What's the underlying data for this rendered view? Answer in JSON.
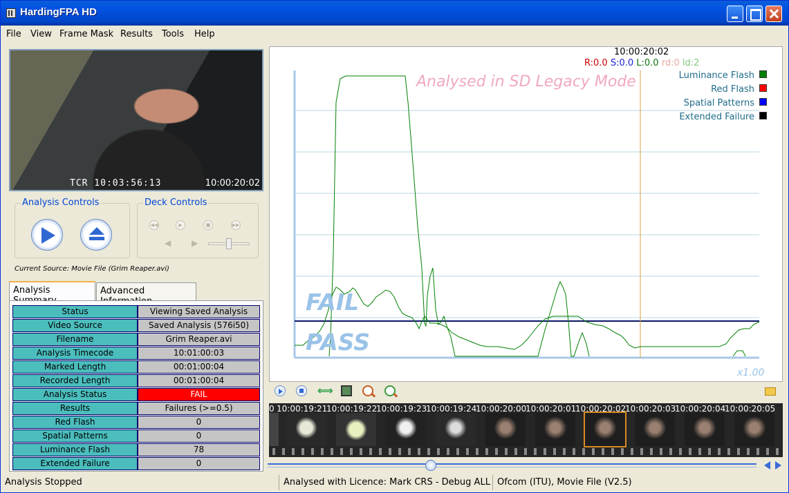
{
  "window": {
    "title": "HardingFPA HD"
  },
  "menu": [
    "File",
    "View",
    "Frame Mask",
    "Results",
    "Tools",
    "Help"
  ],
  "video": {
    "tcr": "TCR 10:03:56:13",
    "timecode": "10:00:20:02"
  },
  "analysis_controls": {
    "label": "Analysis Controls"
  },
  "deck_controls": {
    "label": "Deck Controls"
  },
  "current_source": "Current Source: Movie File (Grim Reaper.avi)",
  "tabs": [
    "Analysis Summary",
    "Advanced Information"
  ],
  "summary": [
    {
      "key": "Status",
      "value": "Viewing Saved Analysis"
    },
    {
      "key": "Video Source",
      "value": "Saved Analysis (576i50)"
    },
    {
      "key": "Filename",
      "value": "Grim Reaper.avi"
    },
    {
      "key": "Analysis Timecode",
      "value": "10:01:00:03"
    },
    {
      "key": "Marked Length",
      "value": "00:01:00:04"
    },
    {
      "key": "Recorded Length",
      "value": "00:01:00:04"
    },
    {
      "key": "Analysis Status",
      "value": "FAIL"
    },
    {
      "key": "Results",
      "value": "Failures (>=0.5)"
    },
    {
      "key": "Red Flash",
      "value": "0"
    },
    {
      "key": "Spatial Patterns",
      "value": "0"
    },
    {
      "key": "Luminance Flash",
      "value": "78"
    },
    {
      "key": "Extended Failure",
      "value": "0"
    }
  ],
  "graph": {
    "timecode": "10:00:20:02",
    "readout": {
      "r": "R:0.0",
      "s": "S:0.0",
      "l": "L:0.0",
      "rd": "rd:0",
      "ld": "ld:2"
    },
    "mode_text": "Analysed in SD Legacy Mode",
    "fail_label": "FAIL",
    "pass_label": "PASS",
    "zoom": "x1.00",
    "legend": [
      {
        "name": "Luminance Flash",
        "color": "#008000"
      },
      {
        "name": "Red Flash",
        "color": "#ff0000"
      },
      {
        "name": "Spatial Patterns",
        "color": "#0000ff"
      },
      {
        "name": "Extended Failure",
        "color": "#000000"
      }
    ],
    "colors": {
      "grid": "#b8d6e6",
      "threshold": "#0a1464",
      "cursor": "#d0a040",
      "series": "#009000",
      "axis": "#a8c8e8"
    }
  },
  "toolbar_icons": [
    "play-icon",
    "stop-icon",
    "fit-width-icon",
    "film-icon",
    "zoom-out-icon",
    "zoom-in-icon",
    "folder-icon"
  ],
  "filmstrip": {
    "frames": [
      "10:00:19:21",
      "10:00:19:22",
      "10:00:19:23",
      "10:00:19:24",
      "10:00:20:00",
      "10:00:20:01",
      "10:00:20:02",
      "10:00:20:03",
      "10:00:20:04",
      "10:00:20:05"
    ],
    "selected_index": 6
  },
  "status_bar": {
    "state": "Analysis Stopped",
    "licence": "Analysed with Licence: Mark CRS - Debug ALL",
    "profile": "Ofcom (ITU), Movie File (V2.5)"
  }
}
